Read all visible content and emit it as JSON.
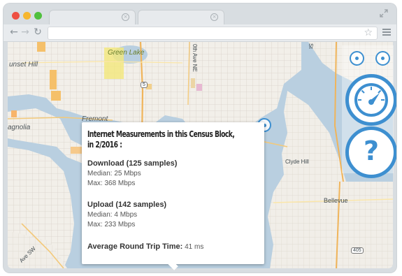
{
  "map": {
    "labels": {
      "sunset_hill": "unset Hill",
      "green_lake": "Green Lake",
      "fremont": "Fremont",
      "magnolia": "agnolia",
      "clyde_hill": "Clyde Hill",
      "bellevue": "Bellevue",
      "tenth_ave": "0th Ave NE",
      "st": "St",
      "ave_sw": "Ave SW",
      "hwy5": "5",
      "hwy405": "405"
    },
    "colors": {
      "water": "#b9cfe0",
      "land": "#f2efe9",
      "control_accent": "#3d8fd0"
    },
    "controls": {
      "zoom_in_icon": "zoom-in-icon",
      "zoom_out_icon": "zoom-out-icon",
      "speed_icon": "speedometer-icon",
      "help_label": "?"
    }
  },
  "popup": {
    "title": "Internet Measurements in this Census Block, in 2/2016 :",
    "download": {
      "heading": "Download (125 samples)",
      "median": "Median: 25 Mbps",
      "max": "Max: 368 Mbps"
    },
    "upload": {
      "heading": "Upload (142 samples)",
      "median": "Median: 4 Mbps",
      "max": "Max: 233 Mbps"
    },
    "rtt_label": "Average Round Trip Time:",
    "rtt_value": " 41 ms"
  }
}
